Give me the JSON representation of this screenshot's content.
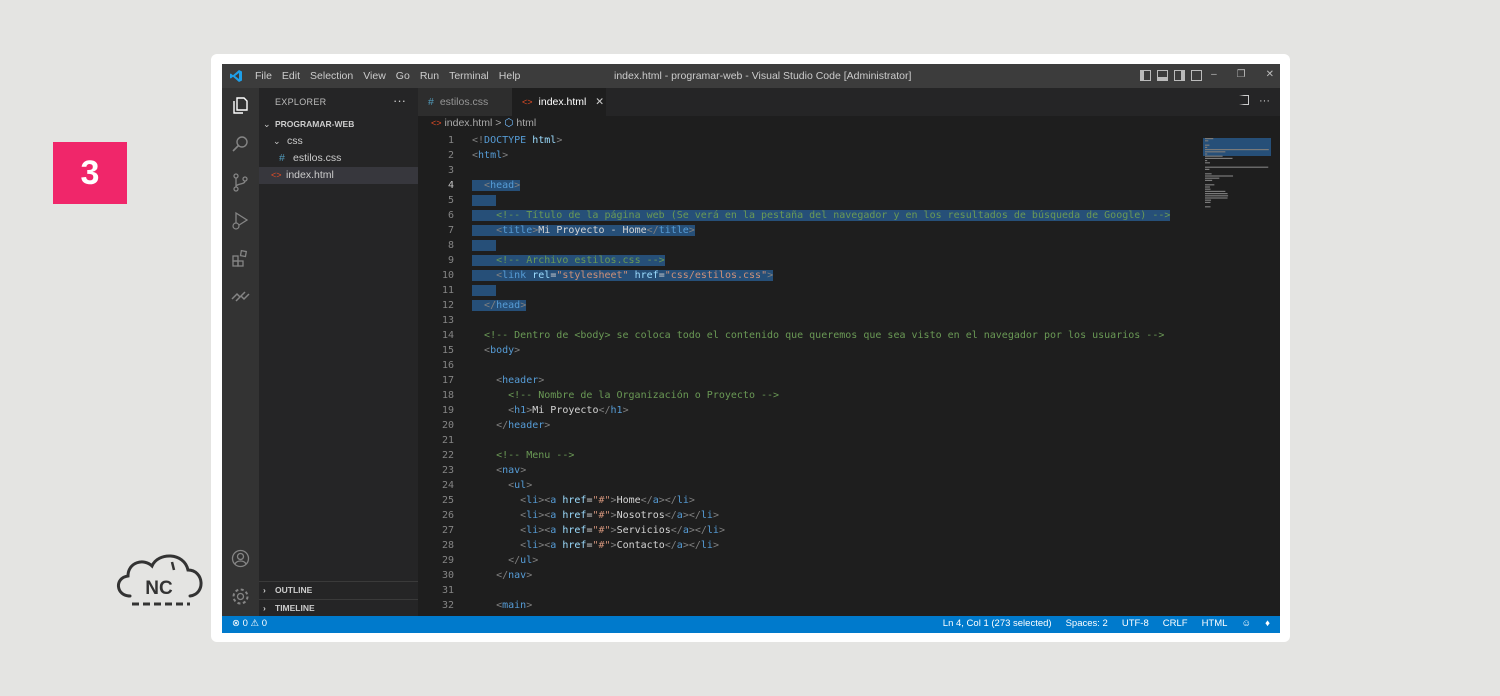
{
  "step_badge": "3",
  "logo_text": "NC",
  "titlebar": {
    "menu": [
      "File",
      "Edit",
      "Selection",
      "View",
      "Go",
      "Run",
      "Terminal",
      "Help"
    ],
    "title": "index.html - programar-web - Visual Studio Code [Administrator]"
  },
  "sidebar": {
    "header": "EXPLORER",
    "more": "···",
    "project": "PROGRAMAR-WEB",
    "folder": "css",
    "file_css": "estilos.css",
    "file_html": "index.html",
    "outline": "OUTLINE",
    "timeline": "TIMELINE"
  },
  "tabs": [
    {
      "label": "estilos.css",
      "icon": "#"
    },
    {
      "label": "index.html",
      "icon": "<>"
    }
  ],
  "breadcrumb": {
    "file": "index.html",
    "sep": ">",
    "symbol": "html"
  },
  "code_lines": [
    {
      "n": "1",
      "t": [
        [
          "br",
          "<!"
        ],
        [
          "tag",
          "DOCTYPE"
        ],
        [
          "txt",
          " "
        ],
        [
          "attr",
          "html"
        ],
        [
          "br",
          ">"
        ]
      ]
    },
    {
      "n": "2",
      "t": [
        [
          "br",
          "<"
        ],
        [
          "tag",
          "html"
        ],
        [
          "br",
          ">"
        ]
      ]
    },
    {
      "n": "3",
      "t": []
    },
    {
      "n": "4",
      "t": [
        [
          "txt",
          "  "
        ],
        [
          "br",
          "<"
        ],
        [
          "tag",
          "head"
        ],
        [
          "br",
          ">"
        ]
      ]
    },
    {
      "n": "5",
      "t": [
        [
          "txt",
          "    "
        ]
      ]
    },
    {
      "n": "6",
      "t": [
        [
          "txt",
          "    "
        ],
        [
          "com",
          "<!-- Título de la página web (Se verá en la pestaña del navegador y en los resultados de búsqueda de Google) -->"
        ]
      ]
    },
    {
      "n": "7",
      "t": [
        [
          "txt",
          "    "
        ],
        [
          "br",
          "<"
        ],
        [
          "tag",
          "title"
        ],
        [
          "br",
          ">"
        ],
        [
          "txt",
          "Mi Proyecto - Home"
        ],
        [
          "br",
          "</"
        ],
        [
          "tag",
          "title"
        ],
        [
          "br",
          ">"
        ]
      ]
    },
    {
      "n": "8",
      "t": [
        [
          "txt",
          "    "
        ]
      ]
    },
    {
      "n": "9",
      "t": [
        [
          "txt",
          "    "
        ],
        [
          "com",
          "<!-- Archivo estilos.css -->"
        ]
      ]
    },
    {
      "n": "10",
      "t": [
        [
          "txt",
          "    "
        ],
        [
          "br",
          "<"
        ],
        [
          "tag",
          "link"
        ],
        [
          "txt",
          " "
        ],
        [
          "attr",
          "rel"
        ],
        [
          "txt",
          "="
        ],
        [
          "str",
          "\"stylesheet\""
        ],
        [
          "txt",
          " "
        ],
        [
          "attr",
          "href"
        ],
        [
          "txt",
          "="
        ],
        [
          "str",
          "\"css/estilos.css\""
        ],
        [
          "br",
          ">"
        ]
      ]
    },
    {
      "n": "11",
      "t": [
        [
          "txt",
          "    "
        ]
      ]
    },
    {
      "n": "12",
      "t": [
        [
          "txt",
          "  "
        ],
        [
          "br",
          "</"
        ],
        [
          "tag",
          "head"
        ],
        [
          "br",
          ">"
        ]
      ]
    },
    {
      "n": "13",
      "t": []
    },
    {
      "n": "14",
      "t": [
        [
          "txt",
          "  "
        ],
        [
          "com",
          "<!-- Dentro de <body> se coloca todo el contenido que queremos que sea visto en el navegador por los usuarios -->"
        ]
      ]
    },
    {
      "n": "15",
      "t": [
        [
          "txt",
          "  "
        ],
        [
          "br",
          "<"
        ],
        [
          "tag",
          "body"
        ],
        [
          "br",
          ">"
        ]
      ]
    },
    {
      "n": "16",
      "t": []
    },
    {
      "n": "17",
      "t": [
        [
          "txt",
          "    "
        ],
        [
          "br",
          "<"
        ],
        [
          "tag",
          "header"
        ],
        [
          "br",
          ">"
        ]
      ]
    },
    {
      "n": "18",
      "t": [
        [
          "txt",
          "      "
        ],
        [
          "com",
          "<!-- Nombre de la Organización o Proyecto -->"
        ]
      ]
    },
    {
      "n": "19",
      "t": [
        [
          "txt",
          "      "
        ],
        [
          "br",
          "<"
        ],
        [
          "tag",
          "h1"
        ],
        [
          "br",
          ">"
        ],
        [
          "txt",
          "Mi Proyecto"
        ],
        [
          "br",
          "</"
        ],
        [
          "tag",
          "h1"
        ],
        [
          "br",
          ">"
        ]
      ]
    },
    {
      "n": "20",
      "t": [
        [
          "txt",
          "    "
        ],
        [
          "br",
          "</"
        ],
        [
          "tag",
          "header"
        ],
        [
          "br",
          ">"
        ]
      ]
    },
    {
      "n": "21",
      "t": []
    },
    {
      "n": "22",
      "t": [
        [
          "txt",
          "    "
        ],
        [
          "com",
          "<!-- Menu -->"
        ]
      ]
    },
    {
      "n": "23",
      "t": [
        [
          "txt",
          "    "
        ],
        [
          "br",
          "<"
        ],
        [
          "tag",
          "nav"
        ],
        [
          "br",
          ">"
        ]
      ]
    },
    {
      "n": "24",
      "t": [
        [
          "txt",
          "      "
        ],
        [
          "br",
          "<"
        ],
        [
          "tag",
          "ul"
        ],
        [
          "br",
          ">"
        ]
      ]
    },
    {
      "n": "25",
      "t": [
        [
          "txt",
          "        "
        ],
        [
          "br",
          "<"
        ],
        [
          "tag",
          "li"
        ],
        [
          "br",
          "><"
        ],
        [
          "tag",
          "a"
        ],
        [
          "txt",
          " "
        ],
        [
          "attr",
          "href"
        ],
        [
          "txt",
          "="
        ],
        [
          "str",
          "\"#\""
        ],
        [
          "br",
          ">"
        ],
        [
          "txt",
          "Home"
        ],
        [
          "br",
          "</"
        ],
        [
          "tag",
          "a"
        ],
        [
          "br",
          "></"
        ],
        [
          "tag",
          "li"
        ],
        [
          "br",
          ">"
        ]
      ]
    },
    {
      "n": "26",
      "t": [
        [
          "txt",
          "        "
        ],
        [
          "br",
          "<"
        ],
        [
          "tag",
          "li"
        ],
        [
          "br",
          "><"
        ],
        [
          "tag",
          "a"
        ],
        [
          "txt",
          " "
        ],
        [
          "attr",
          "href"
        ],
        [
          "txt",
          "="
        ],
        [
          "str",
          "\"#\""
        ],
        [
          "br",
          ">"
        ],
        [
          "txt",
          "Nosotros"
        ],
        [
          "br",
          "</"
        ],
        [
          "tag",
          "a"
        ],
        [
          "br",
          "></"
        ],
        [
          "tag",
          "li"
        ],
        [
          "br",
          ">"
        ]
      ]
    },
    {
      "n": "27",
      "t": [
        [
          "txt",
          "        "
        ],
        [
          "br",
          "<"
        ],
        [
          "tag",
          "li"
        ],
        [
          "br",
          "><"
        ],
        [
          "tag",
          "a"
        ],
        [
          "txt",
          " "
        ],
        [
          "attr",
          "href"
        ],
        [
          "txt",
          "="
        ],
        [
          "str",
          "\"#\""
        ],
        [
          "br",
          ">"
        ],
        [
          "txt",
          "Servicios"
        ],
        [
          "br",
          "</"
        ],
        [
          "tag",
          "a"
        ],
        [
          "br",
          "></"
        ],
        [
          "tag",
          "li"
        ],
        [
          "br",
          ">"
        ]
      ]
    },
    {
      "n": "28",
      "t": [
        [
          "txt",
          "        "
        ],
        [
          "br",
          "<"
        ],
        [
          "tag",
          "li"
        ],
        [
          "br",
          "><"
        ],
        [
          "tag",
          "a"
        ],
        [
          "txt",
          " "
        ],
        [
          "attr",
          "href"
        ],
        [
          "txt",
          "="
        ],
        [
          "str",
          "\"#\""
        ],
        [
          "br",
          ">"
        ],
        [
          "txt",
          "Contacto"
        ],
        [
          "br",
          "</"
        ],
        [
          "tag",
          "a"
        ],
        [
          "br",
          "></"
        ],
        [
          "tag",
          "li"
        ],
        [
          "br",
          ">"
        ]
      ]
    },
    {
      "n": "29",
      "t": [
        [
          "txt",
          "      "
        ],
        [
          "br",
          "</"
        ],
        [
          "tag",
          "ul"
        ],
        [
          "br",
          ">"
        ]
      ]
    },
    {
      "n": "30",
      "t": [
        [
          "txt",
          "    "
        ],
        [
          "br",
          "</"
        ],
        [
          "tag",
          "nav"
        ],
        [
          "br",
          ">"
        ]
      ]
    },
    {
      "n": "31",
      "t": []
    },
    {
      "n": "32",
      "t": [
        [
          "txt",
          "    "
        ],
        [
          "br",
          "<"
        ],
        [
          "tag",
          "main"
        ],
        [
          "br",
          ">"
        ]
      ]
    }
  ],
  "current_line": "4",
  "selected_lines": [
    "4",
    "5",
    "6",
    "7",
    "8",
    "9",
    "10",
    "11",
    "12"
  ],
  "statusbar": {
    "errors": "0",
    "warnings": "0",
    "position": "Ln 4, Col 1 (273 selected)",
    "spaces": "Spaces: 2",
    "encoding": "UTF-8",
    "eol": "CRLF",
    "language": "HTML"
  },
  "colors": {
    "badge": "#f0266a",
    "statusbar": "#007acc",
    "selection": "#264f78",
    "editor_bg": "#1e1e1e"
  }
}
